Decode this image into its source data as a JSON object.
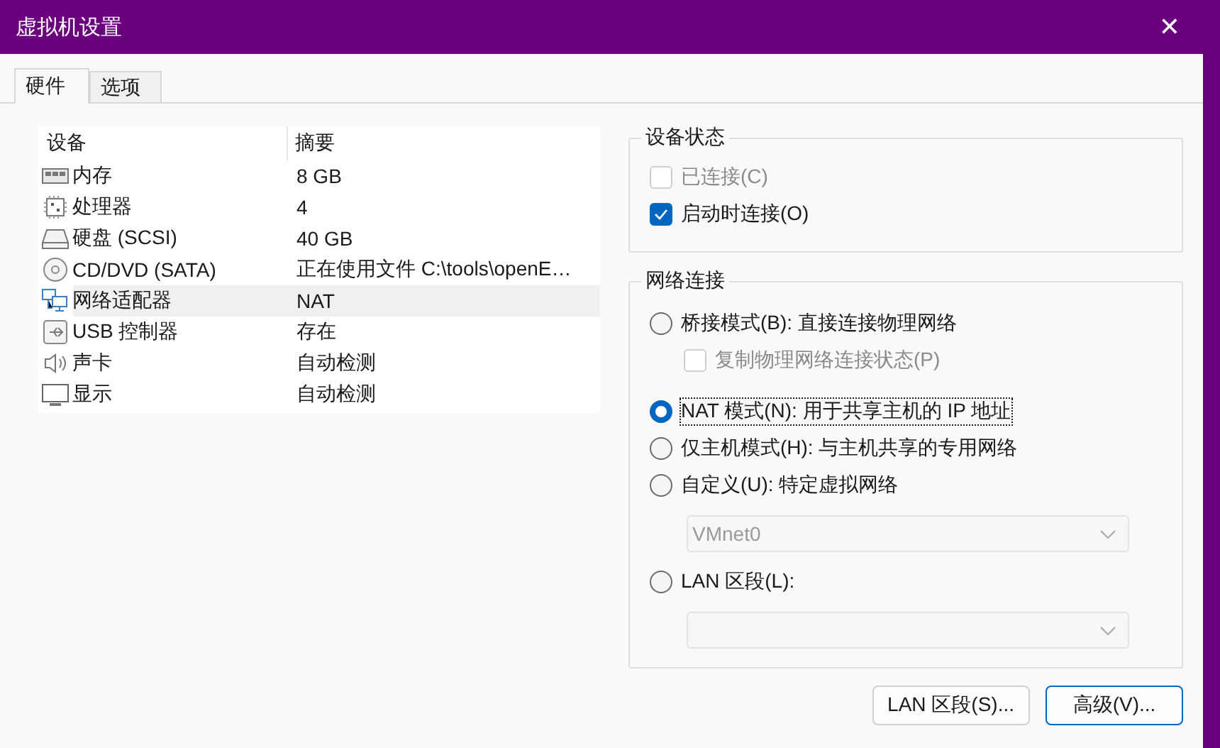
{
  "window": {
    "title": "虚拟机设置",
    "close": "✕"
  },
  "tabs": [
    {
      "label": "硬件",
      "selected": true
    },
    {
      "label": "选项",
      "selected": false
    }
  ],
  "devices": {
    "columns": [
      "设备",
      "摘要"
    ],
    "rows": [
      {
        "kind": "memory",
        "name": "内存",
        "summary": "8 GB",
        "selected": false
      },
      {
        "kind": "cpu",
        "name": "处理器",
        "summary": "4",
        "selected": false
      },
      {
        "kind": "disk",
        "name": "硬盘 (SCSI)",
        "summary": "40 GB",
        "selected": false
      },
      {
        "kind": "cd",
        "name": "CD/DVD (SATA)",
        "summary": "正在使用文件 C:\\tools\\openE…",
        "selected": false
      },
      {
        "kind": "network",
        "name": "网络适配器",
        "summary": "NAT",
        "selected": true
      },
      {
        "kind": "usb",
        "name": "USB 控制器",
        "summary": "存在",
        "selected": false
      },
      {
        "kind": "sound",
        "name": "声卡",
        "summary": "自动检测",
        "selected": false
      },
      {
        "kind": "display",
        "name": "显示",
        "summary": "自动检测",
        "selected": false
      }
    ]
  },
  "device_status": {
    "title": "设备状态",
    "items": [
      {
        "label": "已连接(C)",
        "checked": false,
        "disabled": true
      },
      {
        "label": "启动时连接(O)",
        "checked": true,
        "disabled": false
      }
    ]
  },
  "network": {
    "title": "网络连接",
    "items": [
      {
        "kind": "radio",
        "label": "桥接模式(B): 直接连接物理网络",
        "selected": false,
        "focused": false
      },
      {
        "kind": "checkbox",
        "label": "复制物理网络连接状态(P)",
        "checked": false,
        "disabled": true
      },
      {
        "kind": "radio",
        "label": "NAT 模式(N): 用于共享主机的 IP 地址",
        "selected": true,
        "focused": true
      },
      {
        "kind": "radio",
        "label": "仅主机模式(H): 与主机共享的专用网络",
        "selected": false,
        "focused": false
      },
      {
        "kind": "radio",
        "label": "自定义(U): 特定虚拟网络",
        "selected": false,
        "focused": false
      },
      {
        "kind": "dropdown",
        "value": "VMnet0",
        "disabled": true
      },
      {
        "kind": "radio",
        "label": "LAN 区段(L):",
        "selected": false,
        "focused": false
      },
      {
        "kind": "dropdown",
        "disabled": true
      }
    ]
  },
  "buttons": [
    {
      "label": "LAN 区段(S)...",
      "default": false
    },
    {
      "label": "高级(V)...",
      "default": true
    }
  ]
}
